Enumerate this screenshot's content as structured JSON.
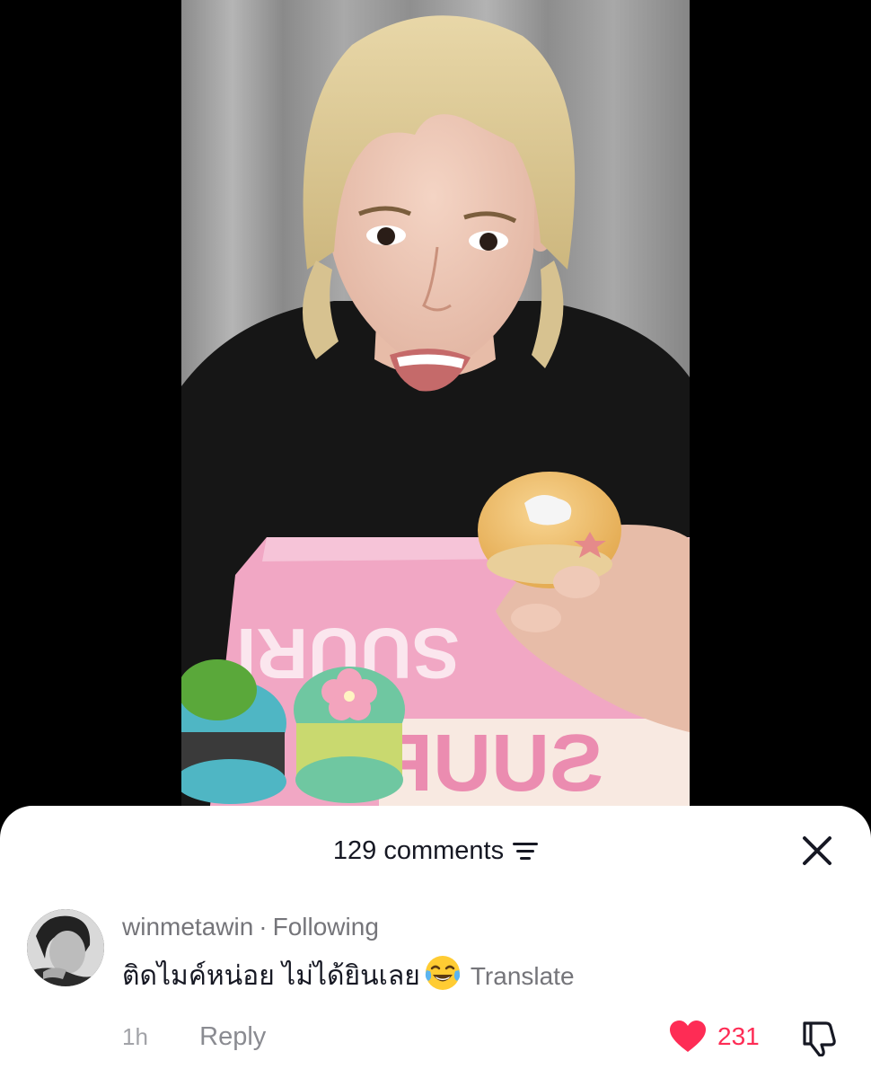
{
  "sheet": {
    "comments_label": "129 comments",
    "filter_icon": "filter-lines-icon",
    "close_icon": "close-icon"
  },
  "comment": {
    "username": "winmetawin",
    "separator": "·",
    "relationship": "Following",
    "text": "ติดไมค์หน่อย ไม่ได้ยินเลย",
    "emoji": "face-with-tears-of-joy",
    "translate_label": "Translate",
    "time": "1h",
    "reply_label": "Reply",
    "like_count": "231",
    "liked": true,
    "like_icon": "heart-icon",
    "dislike_icon": "thumbs-down-icon"
  },
  "colors": {
    "like_red": "#fe2c55",
    "text_primary": "#161823",
    "text_secondary": "#75757a"
  },
  "video": {
    "box_print": "SUURI"
  }
}
